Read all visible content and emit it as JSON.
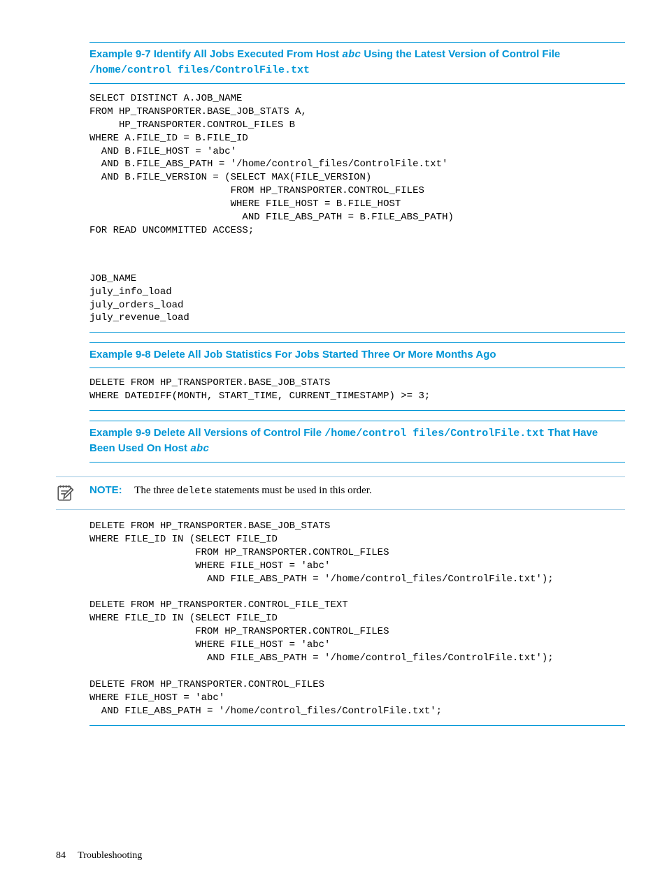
{
  "example97": {
    "heading_parts": {
      "a": "Example 9-7 Identify All Jobs Executed From Host ",
      "b": "abc",
      "c": " Using the Latest Version of Control File ",
      "d": "/home/control files/ControlFile.txt"
    },
    "code": "SELECT DISTINCT A.JOB_NAME\nFROM HP_TRANSPORTER.BASE_JOB_STATS A,\n     HP_TRANSPORTER.CONTROL_FILES B\nWHERE A.FILE_ID = B.FILE_ID\n  AND B.FILE_HOST = 'abc'\n  AND B.FILE_ABS_PATH = '/home/control_files/ControlFile.txt'\n  AND B.FILE_VERSION = (SELECT MAX(FILE_VERSION)\n                        FROM HP_TRANSPORTER.CONTROL_FILES\n                        WHERE FILE_HOST = B.FILE_HOST\n                          AND FILE_ABS_PATH = B.FILE_ABS_PATH)\nFOR READ UNCOMMITTED ACCESS;",
    "result": "JOB_NAME\njuly_info_load\njuly_orders_load\njuly_revenue_load"
  },
  "example98": {
    "heading": "Example 9-8 Delete All Job Statistics For Jobs Started Three Or More Months Ago",
    "code": "DELETE FROM HP_TRANSPORTER.BASE_JOB_STATS\nWHERE DATEDIFF(MONTH, START_TIME, CURRENT_TIMESTAMP) >= 3;"
  },
  "example99": {
    "heading_parts": {
      "a": "Example 9-9 Delete All Versions of Control File ",
      "b": "/home/control files/ControlFile.txt",
      "c": " That Have Been Used On Host ",
      "d": "abc"
    },
    "note_label": "NOTE:",
    "note_text_a": "The three ",
    "note_text_b": "delete",
    "note_text_c": " statements must be used in this order.",
    "code": "DELETE FROM HP_TRANSPORTER.BASE_JOB_STATS\nWHERE FILE_ID IN (SELECT FILE_ID\n                  FROM HP_TRANSPORTER.CONTROL_FILES\n                  WHERE FILE_HOST = 'abc'\n                    AND FILE_ABS_PATH = '/home/control_files/ControlFile.txt');\n\nDELETE FROM HP_TRANSPORTER.CONTROL_FILE_TEXT\nWHERE FILE_ID IN (SELECT FILE_ID\n                  FROM HP_TRANSPORTER.CONTROL_FILES\n                  WHERE FILE_HOST = 'abc'\n                    AND FILE_ABS_PATH = '/home/control_files/ControlFile.txt');\n\nDELETE FROM HP_TRANSPORTER.CONTROL_FILES\nWHERE FILE_HOST = 'abc'\n  AND FILE_ABS_PATH = '/home/control_files/ControlFile.txt';"
  },
  "footer": {
    "pagenum": "84",
    "section": "Troubleshooting"
  }
}
